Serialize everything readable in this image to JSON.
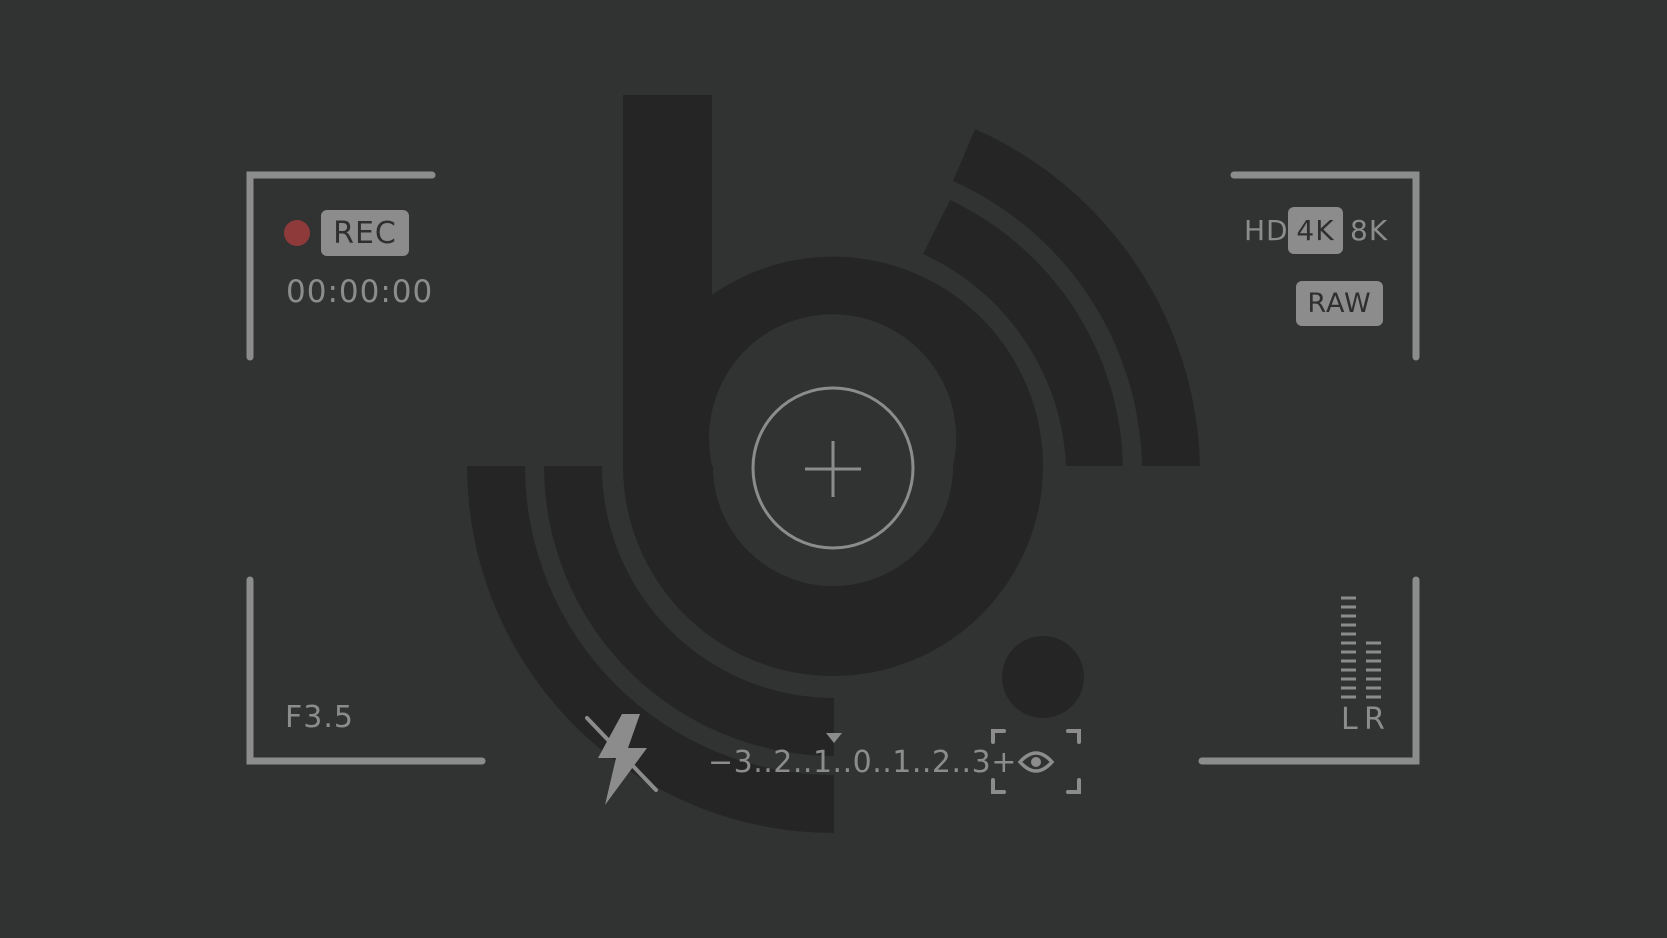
{
  "recording": {
    "label": "REC",
    "timecode": "00:00:00",
    "indicator_color": "#8f3a3a"
  },
  "resolution": {
    "options": [
      "HD",
      "4K",
      "8K"
    ],
    "selected": "4K",
    "format": "RAW"
  },
  "aperture": "F3.5",
  "exposure": {
    "minus": "−",
    "scale": "3..2..1..0..1..2..3",
    "plus": "+",
    "value": 0
  },
  "audio": {
    "left_label": "L",
    "right_label": "R"
  },
  "icons": {
    "flash": "flash-off-icon",
    "metering": "spot-metering-icon",
    "focus": "focus-crosshair-icon"
  },
  "colors": {
    "background": "#313333",
    "logo": "#252526",
    "hud": "#8c8c8c"
  }
}
